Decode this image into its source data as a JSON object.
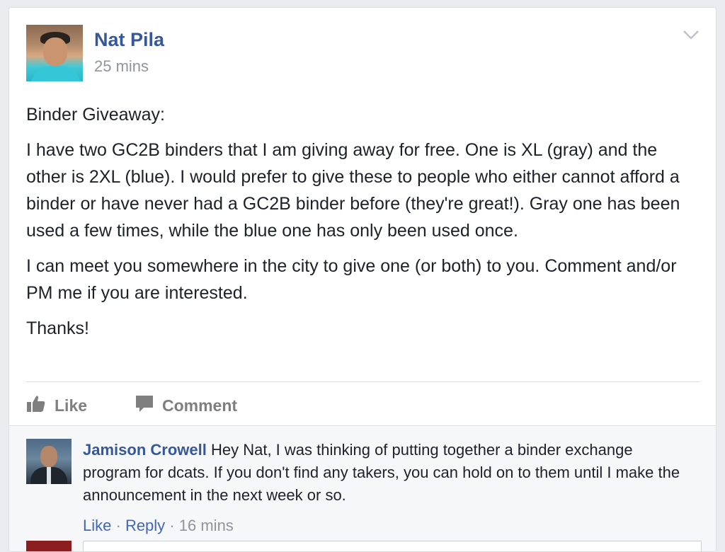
{
  "post": {
    "author": "Nat Pila",
    "time": "25 mins",
    "paragraphs": [
      "Binder Giveaway:",
      "I have two GC2B binders that I am giving away for free. One is XL (gray) and the other is 2XL (blue). I would prefer to give these to people who either cannot afford a binder or have never had a GC2B binder before (they're great!). Gray one has been used a few times, while the blue one has only been used once.",
      "I can meet you somewhere in the city to give one (or both) to you. Comment and/or PM me if you are interested.",
      "Thanks!"
    ]
  },
  "actions": {
    "like": "Like",
    "comment": "Comment"
  },
  "comment": {
    "author": "Jamison Crowell",
    "text": "Hey Nat, I was thinking of putting together a binder exchange program for dcats. If you don't find any takers, you can hold on to them until I make the announcement in the next week or so.",
    "like": "Like",
    "reply": "Reply",
    "separator": "·",
    "time": "16 mins"
  },
  "icons": {
    "options": "chevron-down-icon",
    "like": "thumbs-up-icon",
    "comment": "speech-bubble-icon"
  },
  "colors": {
    "link": "#365899",
    "meta": "#90949c",
    "action": "#7f7f7f",
    "background": "#e9ebee"
  }
}
